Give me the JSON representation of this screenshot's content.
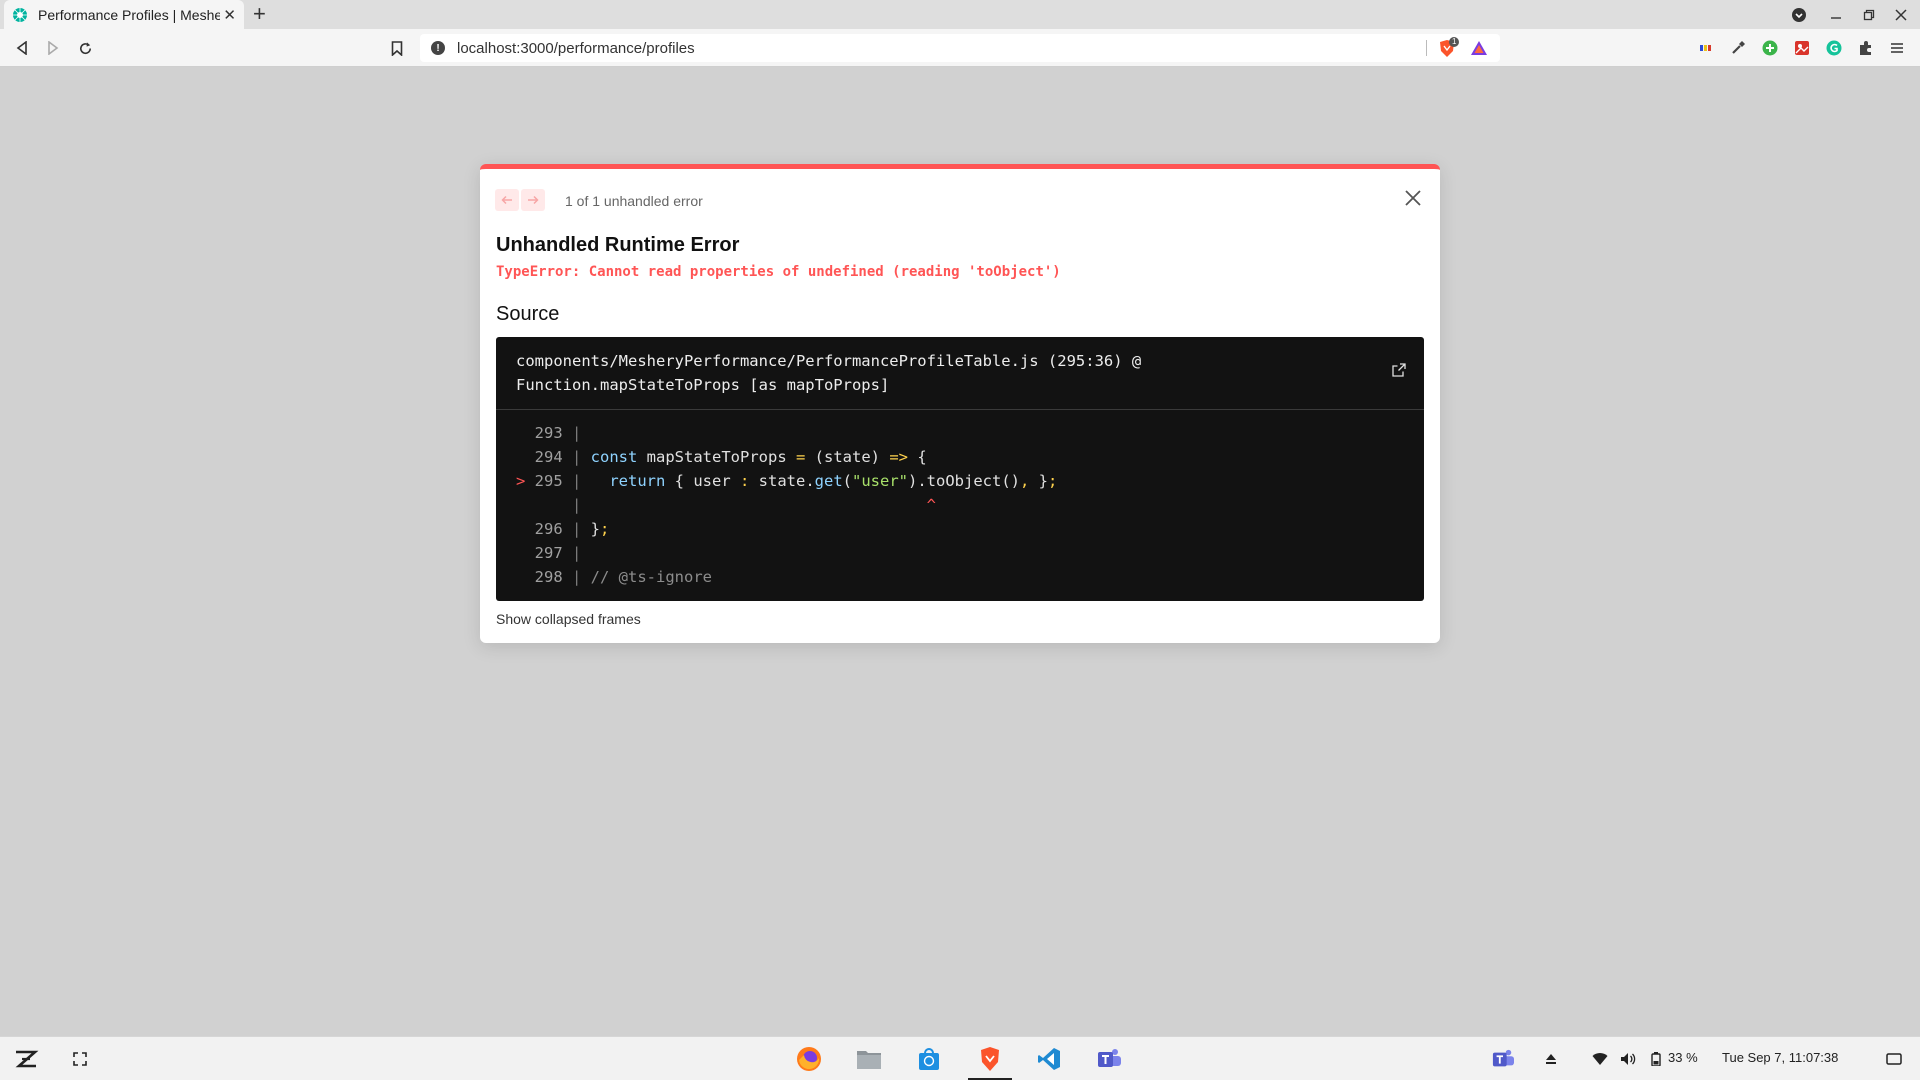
{
  "browser": {
    "tab_title": "Performance Profiles | Meshery",
    "url": "localhost:3000/performance/profiles",
    "shield_badge": "1"
  },
  "error_overlay": {
    "counter": "1 of 1 unhandled error",
    "title": "Unhandled Runtime Error",
    "message": "TypeError: Cannot read properties of undefined (reading 'toObject')",
    "source_heading": "Source",
    "frame_file": "components/MesheryPerformance/PerformanceProfileTable.js (295:36) @",
    "frame_function": "Function.mapStateToProps [as mapToProps]",
    "code_lines": [
      {
        "marker": " ",
        "num": "293",
        "code": ""
      },
      {
        "marker": " ",
        "num": "294",
        "code": "const mapStateToProps = (state) => {"
      },
      {
        "marker": ">",
        "num": "295",
        "code": "  return { user : state.get(\"user\").toObject(), };"
      },
      {
        "marker": " ",
        "num": "",
        "code": "                                    ^"
      },
      {
        "marker": " ",
        "num": "296",
        "code": "};"
      },
      {
        "marker": " ",
        "num": "297",
        "code": ""
      },
      {
        "marker": " ",
        "num": "298",
        "code": "// @ts-ignore"
      }
    ],
    "show_frames": "Show collapsed frames"
  },
  "taskbar": {
    "battery": "33 %",
    "clock": "Tue Sep  7, 11:07:38"
  },
  "colors": {
    "error_red": "#ff5555",
    "code_bg": "#121212",
    "page_bg": "#d1d1d1"
  }
}
